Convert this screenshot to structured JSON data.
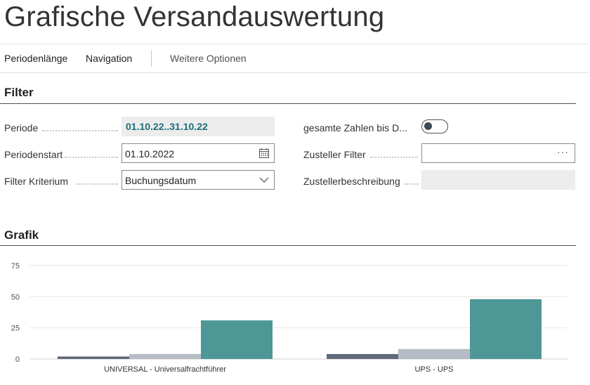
{
  "page": {
    "title": "Grafische Versandauswertung"
  },
  "actions": {
    "period_length": "Periodenlänge",
    "navigation": "Navigation",
    "more_options": "Weitere Optionen"
  },
  "filter": {
    "section_title": "Filter",
    "periode": {
      "label": "Periode",
      "value": "01.10.22..31.10.22"
    },
    "periodenstart": {
      "label": "Periodenstart",
      "value": "01.10.2022"
    },
    "filter_kriterium": {
      "label": "Filter Kriterium",
      "value": "Buchungsdatum"
    },
    "gesamte_zahlen": {
      "label": "gesamte Zahlen bis D...",
      "checked": false
    },
    "zusteller_filter": {
      "label": "Zusteller Filter",
      "value": ""
    },
    "zustellerbeschreibung": {
      "label": "Zustellerbeschreibung",
      "value": ""
    }
  },
  "grafik": {
    "section_title": "Grafik"
  },
  "colors": {
    "accent": "#1a6f7a",
    "bar1": "#5f6b79",
    "bar2": "#b6bcc5",
    "bar3": "#4e9797"
  },
  "chart_data": {
    "type": "bar",
    "categories": [
      "UNIVERSAL - Universalfrachtführer",
      "UPS - UPS"
    ],
    "series": [
      {
        "values": [
          2,
          4
        ]
      },
      {
        "values": [
          4,
          8
        ]
      },
      {
        "values": [
          31,
          48
        ]
      }
    ],
    "yticks": [
      0,
      25,
      50,
      75
    ],
    "ylim": [
      0,
      75
    ],
    "grid": true,
    "legend": "none"
  }
}
